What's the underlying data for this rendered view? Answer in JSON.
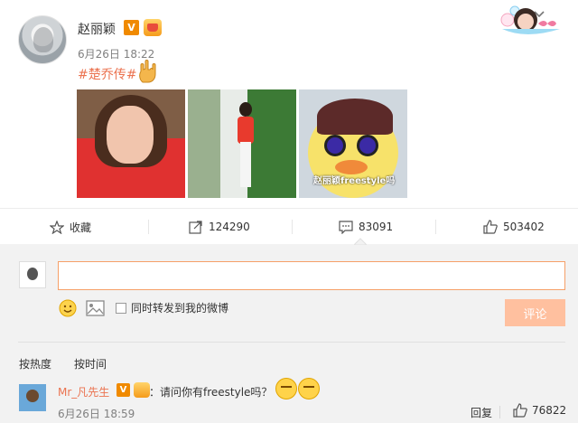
{
  "post": {
    "author": "赵丽颖",
    "vip_mark": "V",
    "time": "6月26日 18:22",
    "hashtag": "#楚乔传#",
    "photos": [
      {
        "icon": "portrait-photo"
      },
      {
        "icon": "street-photo"
      },
      {
        "icon": "duck-meme-photo",
        "caption": "赵丽颖freestyle吗"
      }
    ]
  },
  "actions": {
    "favorite": "收藏",
    "forward_count": "124290",
    "comment_count": "83091",
    "like_count": "503402"
  },
  "composer": {
    "input_value": "",
    "repost_label": "同时转发到我的微博",
    "submit_label": "评论"
  },
  "sort": {
    "hot": "按热度",
    "time": "按时间"
  },
  "comments": [
    {
      "user": "Mr_凡先生",
      "vip_mark": "V",
      "text": "：请问你有freestyle吗？",
      "time": "6月26日 18:59",
      "reply_label": "回复",
      "likes": "76822"
    }
  ],
  "colors": {
    "accent": "#eb7350",
    "vip": "#f08a00",
    "comment_bg": "#f2f2f2",
    "submit_disabled": "#ffc09f"
  }
}
